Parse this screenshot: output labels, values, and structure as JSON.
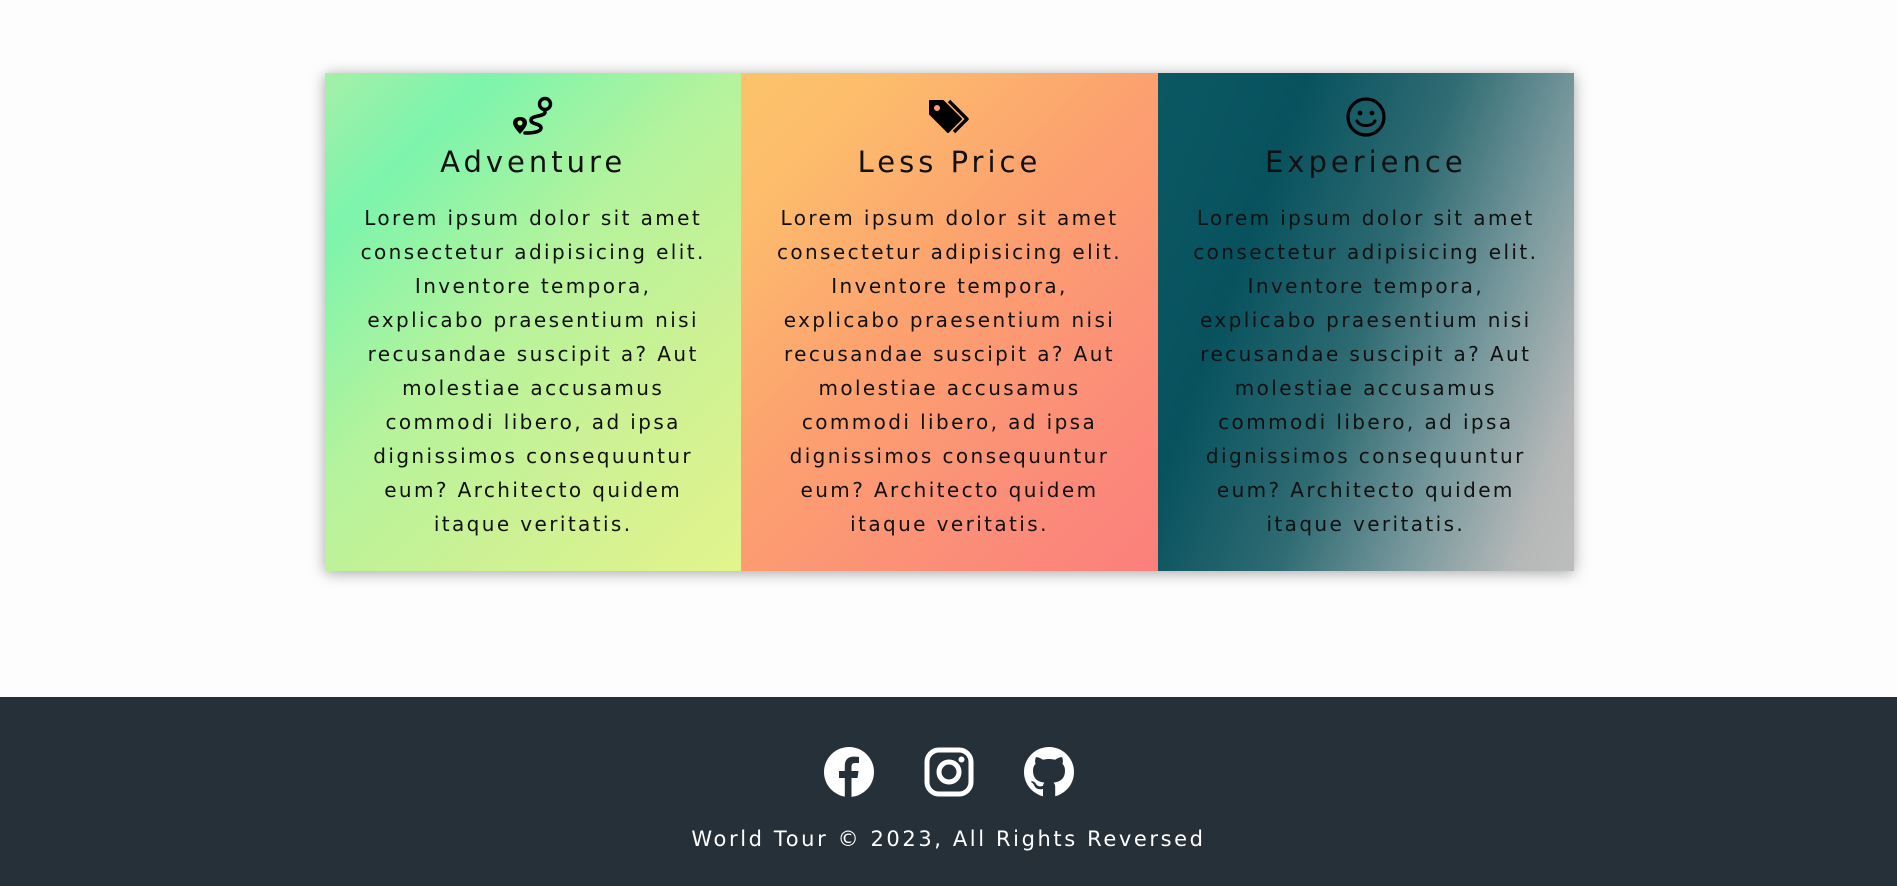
{
  "cards": [
    {
      "icon": "route-icon",
      "title": "Adventure",
      "text": "Lorem ipsum dolor sit amet consectetur adipisicing elit. Inventore tempora, explicabo praesentium nisi recusandae suscipit a? Aut molestiae accusamus commodi libero, ad ipsa dignissimos consequuntur eum? Architecto quidem itaque veritatis."
    },
    {
      "icon": "tags-icon",
      "title": "Less Price",
      "text": "Lorem ipsum dolor sit amet consectetur adipisicing elit. Inventore tempora, explicabo praesentium nisi recusandae suscipit a? Aut molestiae accusamus commodi libero, ad ipsa dignissimos consequuntur eum? Architecto quidem itaque veritatis."
    },
    {
      "icon": "smile-icon",
      "title": "Experience",
      "text": "Lorem ipsum dolor sit amet consectetur adipisicing elit. Inventore tempora, explicabo praesentium nisi recusandae suscipit a? Aut molestiae accusamus commodi libero, ad ipsa dignissimos consequuntur eum? Architecto quidem itaque veritatis."
    }
  ],
  "footer": {
    "socials": [
      "facebook-icon",
      "instagram-icon",
      "github-icon"
    ],
    "copyright": "World Tour © 2023, All Rights Reversed",
    "background": "#263038"
  }
}
